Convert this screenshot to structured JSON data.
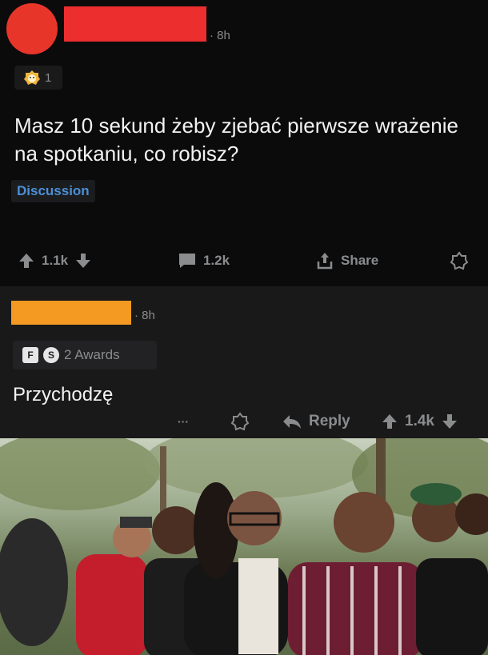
{
  "post": {
    "time": "· 8h",
    "award_count": "1",
    "title": "Masz 10 sekund żeby zjebać pierwsze wrażenie na spotkaniu, co robisz?",
    "flair": "Discussion",
    "actions": {
      "upvotes": "1.1k",
      "comments": "1.2k",
      "share": "Share"
    }
  },
  "comment": {
    "time": "· 8h",
    "awards_label": "2 Awards",
    "award_badges": [
      "F",
      "S"
    ],
    "body": "Przychodzę",
    "actions": {
      "more": "···",
      "reply": "Reply",
      "votes": "1.4k"
    }
  },
  "colors": {
    "post_bg": "#0b0b0c",
    "comment_bg": "#191919",
    "flair_text": "#4b8fd6",
    "avatar_red": "#e8352a",
    "redact_red": "#ec2e2e",
    "redact_orange": "#f49a22",
    "meta_gray": "#8a8c8e"
  }
}
